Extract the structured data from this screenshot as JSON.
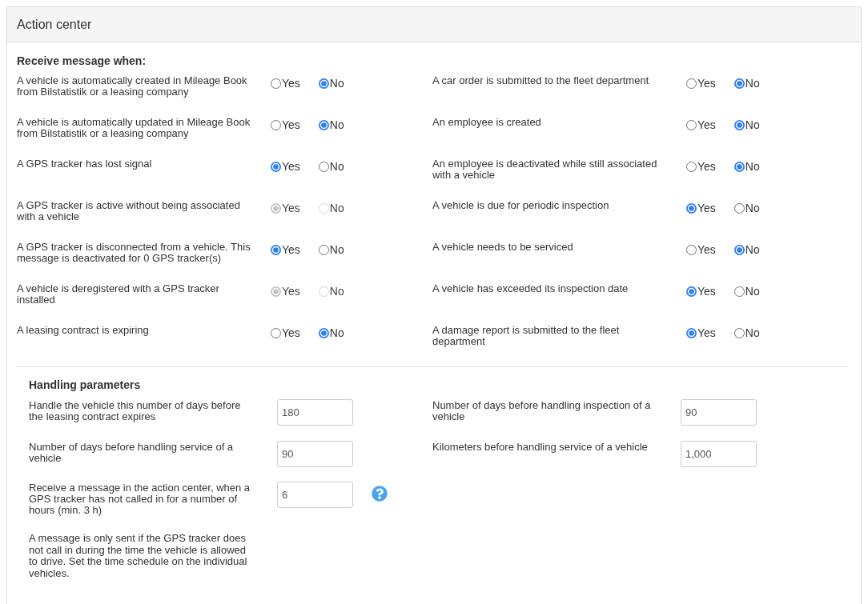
{
  "panel": {
    "title": "Action center"
  },
  "messages": {
    "heading": "Receive message when:",
    "left": [
      {
        "label": "A vehicle is automatically created in Mileage Book from Bilstatistik or a leasing company",
        "disabled": false,
        "options": [
          {
            "label": "Yes",
            "selected": false
          },
          {
            "label": "No",
            "selected": true
          }
        ]
      },
      {
        "label": "A vehicle is automatically updated in Mileage Book from Bilstatistik or a leasing company",
        "disabled": false,
        "options": [
          {
            "label": "Yes",
            "selected": false
          },
          {
            "label": "No",
            "selected": true
          }
        ]
      },
      {
        "label": "A GPS tracker has lost signal",
        "disabled": false,
        "options": [
          {
            "label": "Yes",
            "selected": true
          },
          {
            "label": "No",
            "selected": false
          }
        ]
      },
      {
        "label": "A GPS tracker is active without being associated with a vehicle",
        "disabled": true,
        "options": [
          {
            "label": "Yes",
            "selected": true
          },
          {
            "label": "No",
            "selected": false
          }
        ]
      },
      {
        "label": "A GPS tracker is disconnected from a vehicle. This message is deactivated for 0 GPS tracker(s)",
        "disabled": false,
        "options": [
          {
            "label": "Yes",
            "selected": true
          },
          {
            "label": "No",
            "selected": false
          }
        ]
      },
      {
        "label": "A vehicle is deregistered with a GPS tracker installed",
        "disabled": true,
        "options": [
          {
            "label": "Yes",
            "selected": true
          },
          {
            "label": "No",
            "selected": false
          }
        ]
      },
      {
        "label": "A leasing contract is expiring",
        "disabled": false,
        "options": [
          {
            "label": "Yes",
            "selected": false
          },
          {
            "label": "No",
            "selected": true
          }
        ]
      }
    ],
    "right": [
      {
        "label": "A car order is submitted to the fleet department",
        "disabled": false,
        "options": [
          {
            "label": "Yes",
            "selected": false
          },
          {
            "label": "No",
            "selected": true
          }
        ]
      },
      {
        "label": "An employee is created",
        "disabled": false,
        "options": [
          {
            "label": "Yes",
            "selected": false
          },
          {
            "label": "No",
            "selected": true
          }
        ]
      },
      {
        "label": "An employee is deactivated while still associated with a vehicle",
        "disabled": false,
        "options": [
          {
            "label": "Yes",
            "selected": false
          },
          {
            "label": "No",
            "selected": true
          }
        ]
      },
      {
        "label": "A vehicle is due for periodic inspection",
        "disabled": false,
        "options": [
          {
            "label": "Yes",
            "selected": true
          },
          {
            "label": "No",
            "selected": false
          }
        ]
      },
      {
        "label": "A vehicle needs to be serviced",
        "disabled": false,
        "options": [
          {
            "label": "Yes",
            "selected": false
          },
          {
            "label": "No",
            "selected": true
          }
        ]
      },
      {
        "label": "A vehicle has exceeded its inspection date",
        "disabled": false,
        "options": [
          {
            "label": "Yes",
            "selected": true
          },
          {
            "label": "No",
            "selected": false
          }
        ]
      },
      {
        "label": "A damage report is submitted to the fleet department",
        "disabled": false,
        "options": [
          {
            "label": "Yes",
            "selected": true
          },
          {
            "label": "No",
            "selected": false
          }
        ]
      }
    ]
  },
  "handling": {
    "heading": "Handling parameters",
    "left": [
      {
        "label": "Handle the vehicle this number of days before the leasing contract expires",
        "value": "180",
        "help": false
      },
      {
        "label": "Number of days before handling service of a vehicle",
        "value": "90",
        "help": false
      },
      {
        "label": "Receive a message in the action center, when a GPS tracker has not called in for a number of hours (min. 3 h)",
        "value": "6",
        "help": true
      }
    ],
    "right": [
      {
        "label": "Number of days before handling inspection of a vehicle",
        "value": "90",
        "help": false
      },
      {
        "label": "Kilometers before handling service of a vehicle",
        "value": "1,000",
        "help": false
      }
    ],
    "note": "A message is only sent if the GPS tracker does not call in during the time the vehicle is allowed to drive. Set the time schedule on the individual vehicles."
  }
}
